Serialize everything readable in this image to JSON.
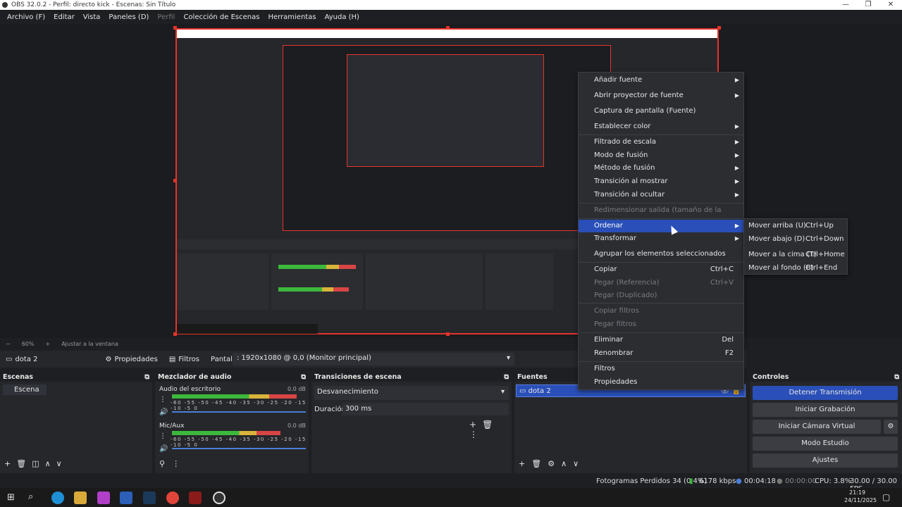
{
  "window": {
    "title": "OBS 32.0.2 - Perfil: directo kick - Escenas: Sin Título",
    "min": "—",
    "max": "❐",
    "close": "✕"
  },
  "menubar": [
    "Archivo (F)",
    "Editar",
    "Vista",
    "Paneles (D)",
    "Perfil",
    "Colección de Escenas",
    "Herramientas",
    "Ayuda (H)"
  ],
  "zoom": {
    "level": "60%",
    "fit": "Ajustar a la ventana"
  },
  "source_bar": {
    "source": "dota 2",
    "properties": "Propiedades",
    "filters": "Filtros",
    "screen_label": "Pantalla",
    "screen_value": ": 1920x1080 @ 0,0 (Monitor principal)"
  },
  "scenes": {
    "title": "Escenas",
    "items": [
      "Escena"
    ]
  },
  "mixer": {
    "title": "Mezclador de audio",
    "scale": "-60 -55 -50 -45 -40 -35 -30 -25 -20 -15 -10 -5 0",
    "channels": [
      {
        "name": "Audio del escritorio",
        "db": "0.0 dB",
        "level": 0.93
      },
      {
        "name": "Mic/Aux",
        "db": "0.0 dB",
        "level": 0.81
      }
    ]
  },
  "transitions": {
    "title": "Transiciones de escena",
    "selected": "Desvanecimiento",
    "duration_label": "Duración",
    "duration_value": "300 ms"
  },
  "sources": {
    "title": "Fuentes",
    "items": [
      "dota 2"
    ]
  },
  "controls": {
    "title": "Controles",
    "buttons": [
      "Detener Transmisión",
      "Iniciar Grabación",
      "Iniciar Cámara Virtual",
      "Modo Estudio",
      "Ajustes"
    ]
  },
  "status": {
    "dropped": "Fotogramas Perdidos 34 (0.4%)",
    "bitrate": "6178 kbps",
    "stream_time": "00:04:18",
    "rec_time": "00:00:00",
    "cpu": "CPU: 3.8%",
    "fps": "30.00 / 30.00 FPS"
  },
  "taskbar": {
    "time": "21:19",
    "date": "24/11/2025"
  },
  "context_menu": {
    "items": [
      {
        "label": "Añadir fuente",
        "arrow": "▶"
      },
      {
        "label": "Abrir proyector de fuente",
        "arrow": "▶"
      },
      {
        "label": "Captura de pantalla (Fuente)"
      },
      {
        "label": "Establecer color",
        "arrow": "▶"
      },
      {
        "label": "Filtrado de escala",
        "arrow": "▶"
      },
      {
        "label": "Modo de fusión",
        "arrow": "▶"
      },
      {
        "label": "Método de fusión",
        "arrow": "▶"
      },
      {
        "label": "Transición al mostrar",
        "arrow": "▶"
      },
      {
        "label": "Transición al ocultar",
        "arrow": "▶"
      },
      {
        "label": "Redimensionar salida (tamaño de la fuente)"
      },
      {
        "label": "Ordenar",
        "arrow": "▶"
      },
      {
        "label": "Transformar",
        "arrow": "▶"
      },
      {
        "label": "Agrupar los elementos seleccionados"
      },
      {
        "label": "Copiar",
        "shortcut": "Ctrl+C"
      },
      {
        "label": "Pegar (Referencia)",
        "shortcut": "Ctrl+V"
      },
      {
        "label": "Pegar (Duplicado)"
      },
      {
        "label": "Copiar filtros"
      },
      {
        "label": "Pegar filtros"
      },
      {
        "label": "Eliminar",
        "shortcut": "Del"
      },
      {
        "label": "Renombrar",
        "shortcut": "F2"
      },
      {
        "label": "Filtros"
      },
      {
        "label": "Propiedades"
      }
    ]
  },
  "submenu": {
    "items": [
      {
        "label": "Mover arriba (U)",
        "shortcut": "Ctrl+Up"
      },
      {
        "label": "Mover abajo (D)",
        "shortcut": "Ctrl+Down"
      },
      {
        "label": "Mover a la cima (T)",
        "shortcut": "Ctrl+Home"
      },
      {
        "label": "Mover al fondo (B)",
        "shortcut": "Ctrl+End"
      }
    ]
  }
}
